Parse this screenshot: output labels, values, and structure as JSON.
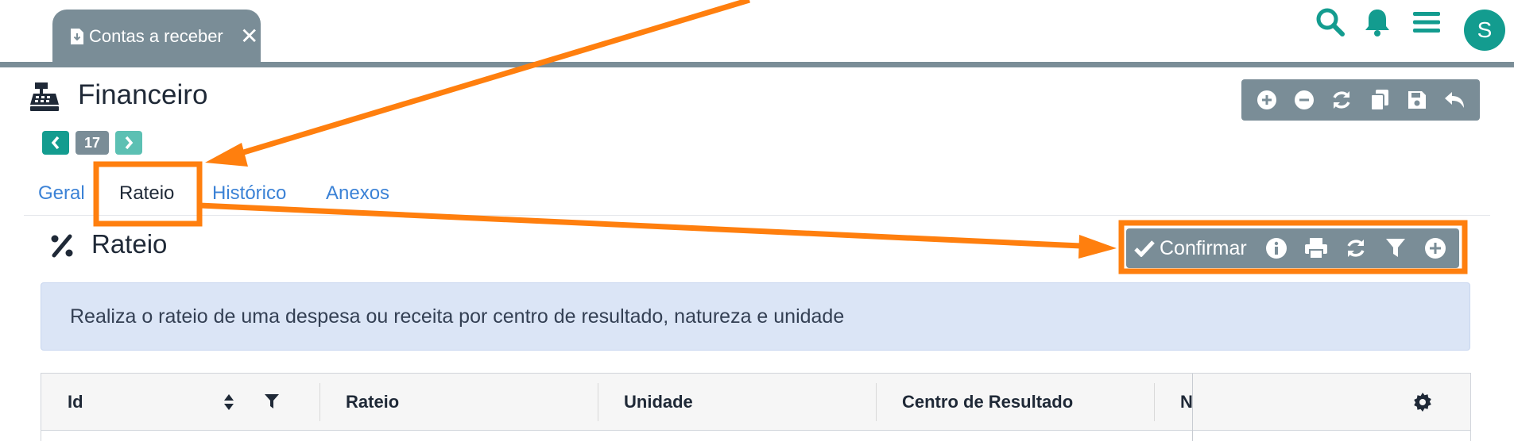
{
  "doc_tab": {
    "label": "Contas a receber",
    "icon": "download-file-icon",
    "close_icon": "close-icon"
  },
  "top_icons": [
    "search-icon",
    "bell-icon",
    "hamburger-menu-icon"
  ],
  "user": {
    "avatar_initial": "S"
  },
  "page": {
    "title": "Financeiro",
    "icon": "cash-register-icon"
  },
  "pager": {
    "current": "17"
  },
  "header_toolbar": [
    "add-circle-icon",
    "remove-circle-icon",
    "refresh-icon",
    "copy-icon",
    "save-icon",
    "undo-icon"
  ],
  "tabs": [
    {
      "label": "Geral",
      "active": false
    },
    {
      "label": "Rateio",
      "active": true
    },
    {
      "label": "Histórico",
      "active": false
    },
    {
      "label": "Anexos",
      "active": false
    }
  ],
  "section": {
    "title": "Rateio",
    "icon": "percent-icon",
    "confirm_label": "Confirmar",
    "toolbar_icons": [
      "info-icon",
      "print-icon",
      "refresh-icon",
      "filter-icon",
      "add-circle-icon"
    ]
  },
  "info_text": "Realiza o rateio de uma despesa ou receita por centro de resultado, natureza e unidade",
  "table": {
    "columns": [
      "Id",
      "Rateio",
      "Unidade",
      "Centro de Resultado",
      "N"
    ]
  },
  "colors": {
    "accent": "#139c8f",
    "toolbar": "#7a8d97",
    "link": "#3b82d6",
    "annotation": "#ff7f0e",
    "info_bg": "#dbe5f6"
  }
}
